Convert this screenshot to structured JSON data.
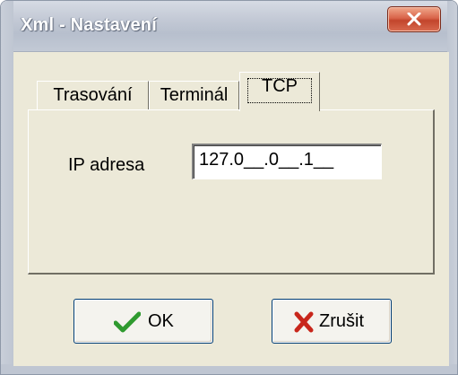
{
  "window": {
    "title": "Xml - Nastavení",
    "close_label": "x"
  },
  "tabs": [
    {
      "label": "Trasování",
      "active": false
    },
    {
      "label": "Terminál",
      "active": false
    },
    {
      "label": "TCP",
      "active": true
    }
  ],
  "tcp_panel": {
    "ip_label": "IP adresa",
    "ip_value": "127.0__.0__.1__"
  },
  "buttons": {
    "ok_label": "OK",
    "ok_icon": "checkmark-icon",
    "cancel_label": "Zrušit",
    "cancel_icon": "red-x-icon"
  },
  "colors": {
    "ok_icon": "#2f9a2f",
    "cancel_icon": "#c8261b",
    "close_button": "#c2452c"
  }
}
